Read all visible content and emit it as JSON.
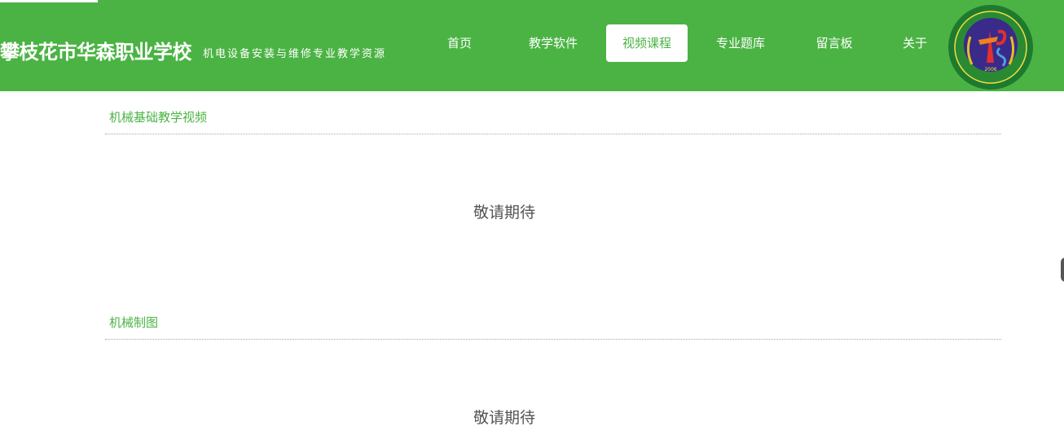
{
  "header": {
    "title": "攀枝花市华森职业学校",
    "subtitle": "机电设备安装与维修专业教学资源",
    "logo_icon": "school-emblem-logo",
    "logo_year": "2006",
    "background_color": "#4bb344"
  },
  "nav": {
    "items": [
      {
        "label": "首页",
        "active": false
      },
      {
        "label": "教学软件",
        "active": false
      },
      {
        "label": "视频课程",
        "active": true
      },
      {
        "label": "专业题库",
        "active": false
      },
      {
        "label": "留言板",
        "active": false
      },
      {
        "label": "关于",
        "active": false
      }
    ]
  },
  "sections": [
    {
      "title": "机械基础教学视频",
      "placeholder": "敬请期待"
    },
    {
      "title": "机械制图",
      "placeholder": "敬请期待"
    }
  ],
  "colors": {
    "accent": "#4bb344",
    "active_nav_bg": "#ffffff",
    "placeholder_text": "#555555"
  }
}
